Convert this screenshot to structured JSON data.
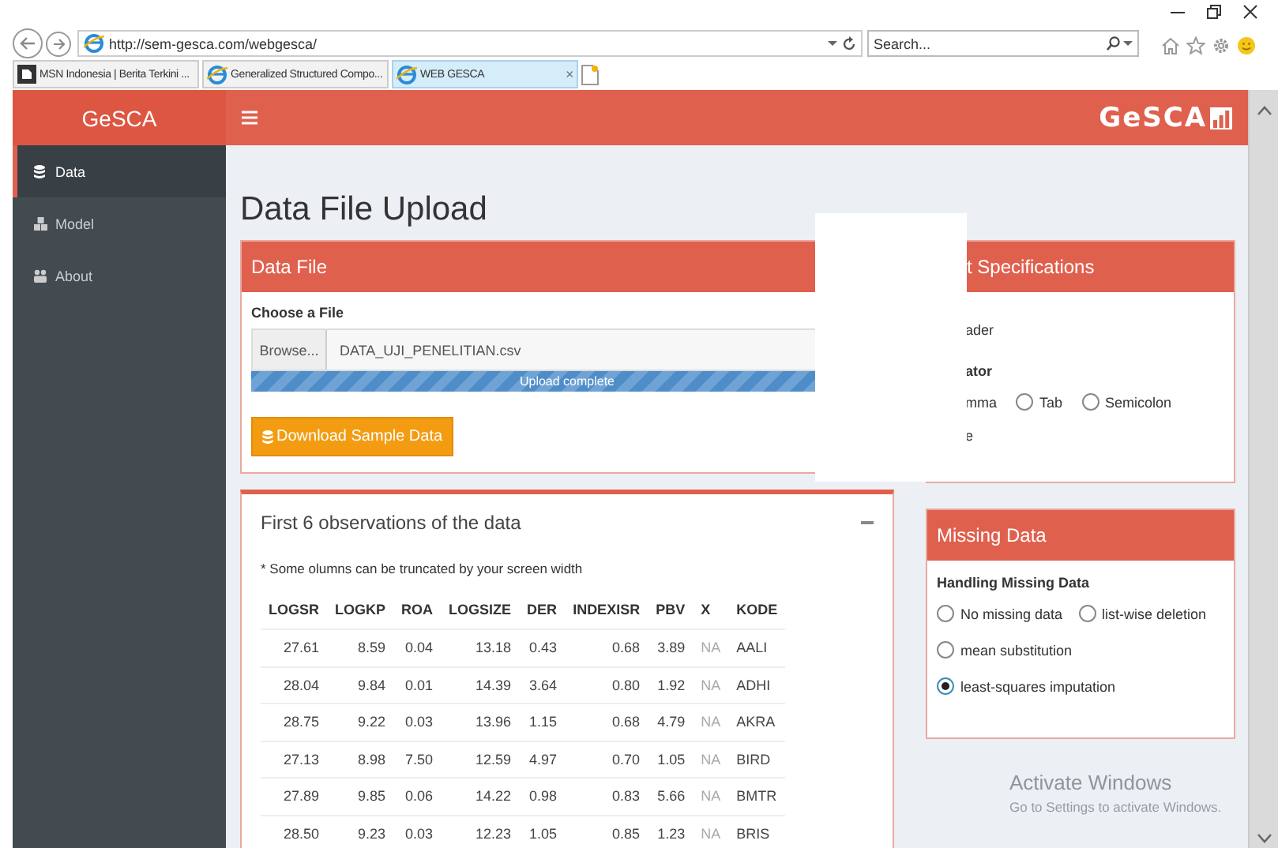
{
  "browser": {
    "address": "http://sem-gesca.com/webgesca/",
    "search": {
      "placeholder": "Search..."
    },
    "tabs": [
      {
        "title": "MSN Indonesia | Berita Terkini ...",
        "kind": "square",
        "selected": false
      },
      {
        "title": "Generalized Structured Compo...",
        "kind": "globe",
        "selected": false
      },
      {
        "title": "WEB GESCA",
        "kind": "globe",
        "selected": true,
        "close_mark": "×"
      }
    ]
  },
  "app": {
    "brand": "GeSCA",
    "logo": "GeSCA",
    "sidebar": [
      {
        "label": "Data",
        "kind": "database",
        "selected": true
      },
      {
        "label": "Model",
        "kind": "cubes",
        "selected": false
      },
      {
        "label": "About",
        "kind": "users",
        "selected": false
      }
    ],
    "page_title": "Data File Upload",
    "data_file": {
      "title": "Data File",
      "file_label": "Choose a File",
      "browse": "Browse...",
      "file_name": "DATA_UJI_PENELITIAN.csv",
      "progress": {
        "level": 1,
        "text": "Upload complete"
      },
      "download": "Download Sample Data"
    },
    "preview": {
      "title": "First 6 observations of the data",
      "note": "* Some olumns can be truncated by your screen width",
      "columns": [
        "LOGSR",
        "LOGKP",
        "ROA",
        "LOGSIZE",
        "DER",
        "INDEXISR",
        "PBV",
        "X",
        "KODE"
      ],
      "rows": [
        [
          "27.61",
          "8.59",
          "0.04",
          "13.18",
          "0.43",
          "0.68",
          "3.89",
          "NA",
          "AALI"
        ],
        [
          "28.04",
          "9.84",
          "0.01",
          "14.39",
          "3.64",
          "0.80",
          "1.92",
          "NA",
          "ADHI"
        ],
        [
          "28.75",
          "9.22",
          "0.03",
          "13.96",
          "1.15",
          "0.68",
          "4.79",
          "NA",
          "AKRA"
        ],
        [
          "27.13",
          "8.98",
          "7.50",
          "12.59",
          "4.97",
          "0.70",
          "1.05",
          "NA",
          "BIRD"
        ],
        [
          "27.89",
          "9.85",
          "0.06",
          "14.22",
          "0.98",
          "0.83",
          "5.66",
          "NA",
          "BMTR"
        ],
        [
          "28.50",
          "9.23",
          "0.03",
          "12.23",
          "1.05",
          "0.85",
          "1.23",
          "NA",
          "BRIS"
        ]
      ]
    },
    "input_specs": {
      "title": "t Specifications",
      "lines": [
        {
          "kind": "text",
          "text": "ader"
        },
        {
          "kind": "label",
          "text": "ator"
        },
        {
          "kind": "radios",
          "options": [
            {
              "kind": "fragment",
              "label": "mma"
            },
            {
              "kind": "radio",
              "label": "Tab",
              "selected": false
            },
            {
              "kind": "radio",
              "label": "Semicolon",
              "selected": false
            }
          ]
        },
        {
          "kind": "text",
          "text": "e"
        }
      ]
    },
    "missing_data": {
      "title": "Missing Data",
      "label": "Handling Missing Data",
      "option_rows": [
        [
          {
            "label": "No missing data",
            "selected": false
          },
          {
            "label": "list-wise deletion",
            "selected": false
          }
        ],
        [
          {
            "label": "mean substitution",
            "selected": false
          }
        ],
        [
          {
            "label": "least-squares imputation",
            "selected": true
          }
        ]
      ]
    }
  },
  "os_notice": {
    "title": "Activate Windows",
    "text": "Go to Settings to activate Windows."
  }
}
